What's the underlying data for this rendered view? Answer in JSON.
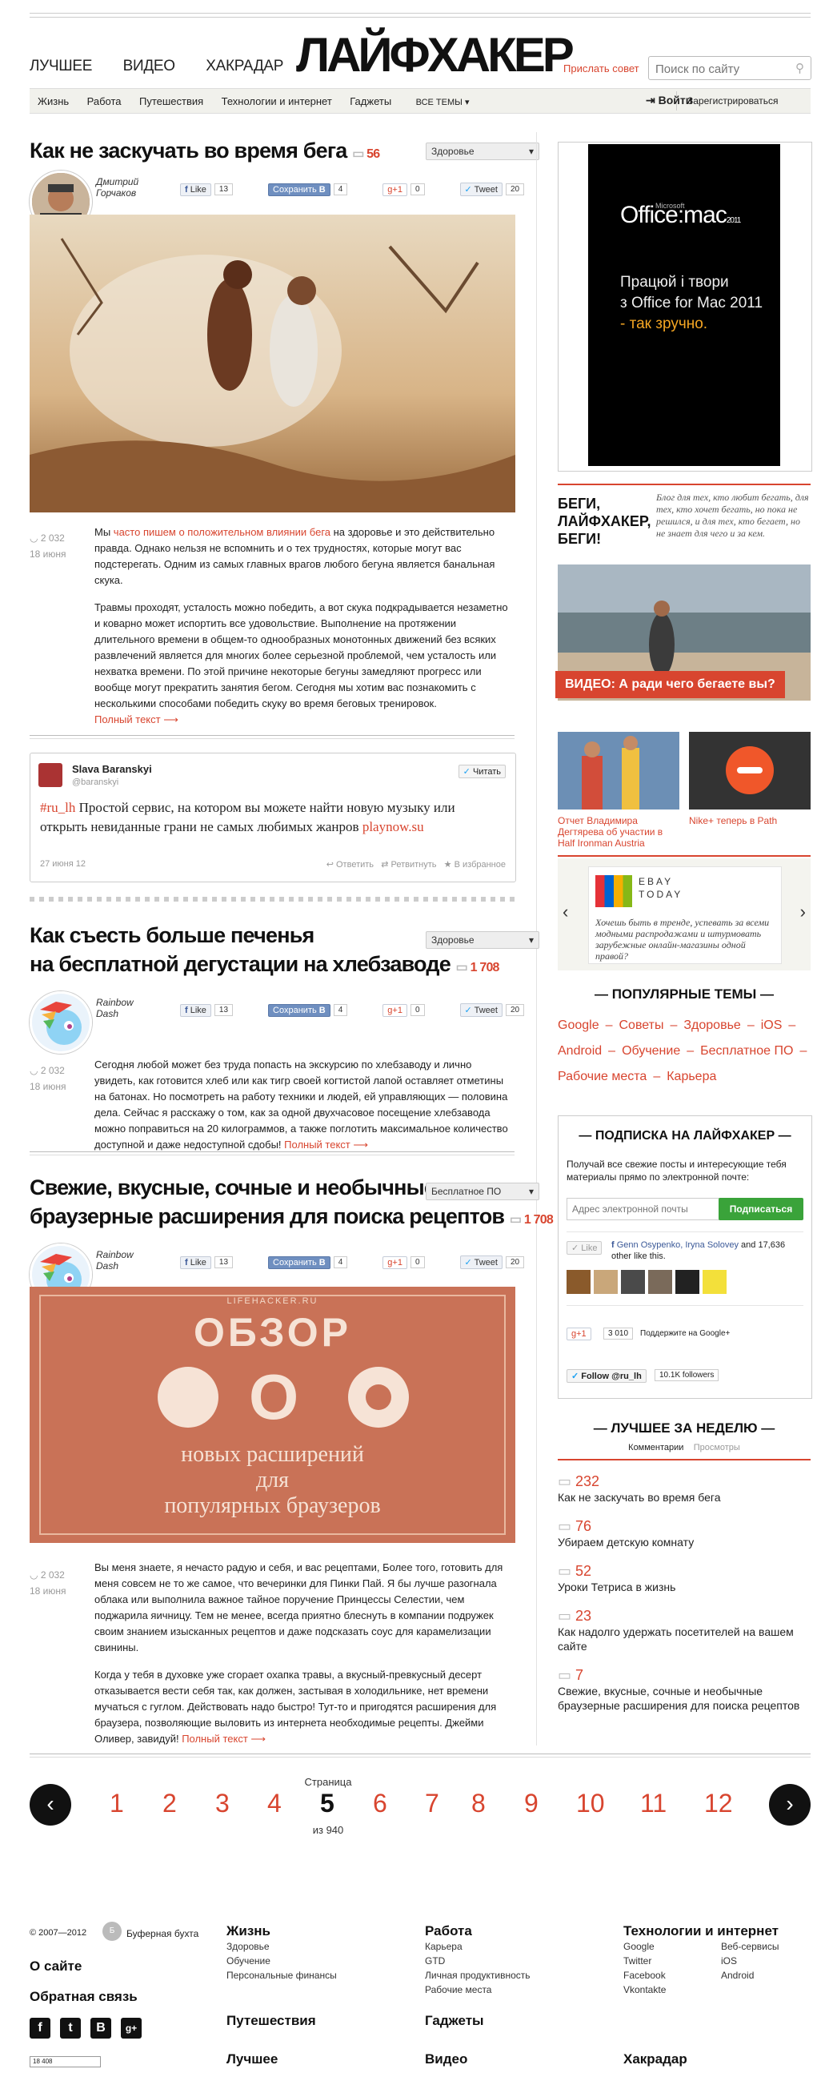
{
  "header": {
    "nav": [
      "ЛУЧШЕЕ",
      "ВИДЕО",
      "ХАКРАДАР"
    ],
    "logo": "ЛАЙФХАКЕР",
    "send_tip": "Прислать совет",
    "search_placeholder": "Поиск по сайту",
    "categories": [
      "Жизнь",
      "Работа",
      "Путешествия",
      "Технологии и интернет",
      "Гаджеты"
    ],
    "all_topics": "ВСЕ ТЕМЫ",
    "login": "Войти",
    "register": "Зарегистрироваться"
  },
  "share": {
    "like": "Like",
    "save": "Сохранить",
    "plus": "+1",
    "tweet": "Tweet"
  },
  "posts": [
    {
      "title": "Как не заскучать во время бега",
      "comments": "56",
      "tag": "Здоровье",
      "author_first": "Дмитрий",
      "author_last": "Горчаков",
      "like_count": "13",
      "save_count": "4",
      "plus_count": "0",
      "tweet_count": "20",
      "views": "2 032",
      "date": "18 июня",
      "p1_a": "Мы ",
      "p1_link": "часто пишем о положительном влиянии бега",
      "p1_b": " на здоровье и это действительно правда. Однако нельзя не вспомнить и о тех трудностях, которые могут вас подстерегать. Одним из самых главных врагов любого бегуна является банальная скука.",
      "p2": "Травмы проходят, усталость можно победить, а вот скука подкрадывается незаметно и коварно может испортить все удовольствие. Выполнение на протяжении длительного времени в общем-то однообразных монотонных движений без всяких развлечений является для многих более серьезной проблемой, чем усталость или нехватка времени. По этой причине некоторые бегуны замедляют прогресс или вообще могут прекратить занятия бегом. Сегодня мы хотим вас познакомить с несколькими способами победить скуку во время беговых тренировок.",
      "more": "Полный текст ⟶"
    },
    {
      "title_l1": "Как съесть больше печенья",
      "title_l2": "на бесплатной дегустации на хлебзаводе",
      "comments": "1 708",
      "tag": "Здоровье",
      "author_first": "Rainbow",
      "author_last": "Dash",
      "like_count": "13",
      "save_count": "4",
      "plus_count": "0",
      "tweet_count": "20",
      "views": "2 032",
      "date": "18 июня",
      "p1": "Сегодня любой может без труда попасть на экскурсию по хлебзаводу и лично увидеть, как готовится хлеб или как тигр своей когтистой лапой оставляет отметины на батонах. Но посмотреть на работу техники и людей, ей управляющих — половина дела. Сейчас я расскажу о том, как за одной двухчасовое посещение хлебзавода можно поправиться на 20 килограммов, а также поглотить максимальное количество доступной и даже недоступной сдобы! ",
      "more": "Полный текст ⟶"
    },
    {
      "title_l1": "Свежие, вкусные, сочные и необычные",
      "title_l2": "браузерные расширения для поиска рецептов",
      "comments": "1 708",
      "tag": "Бесплатное ПО",
      "author_first": "Rainbow",
      "author_last": "Dash",
      "like_count": "13",
      "save_count": "4",
      "plus_count": "0",
      "tweet_count": "20",
      "banner_site": "LIFEHACKER.RU",
      "banner_title": "ОБЗОР",
      "banner_line1": "новых расширений",
      "banner_line2": "для",
      "banner_line3": "популярных браузеров",
      "views": "2 032",
      "date": "18 июня",
      "p1": "Вы меня знаете, я нечасто радую и себя, и вас рецептами, Более того, готовить для меня совсем не то же самое, что вечеринки для Пинки Пай. Я бы лучше разогнала облака или выполнила важное тайное поручение Принцессы Селестии, чем поджарила яичницу. Тем не менее, всегда приятно блеснуть в компании подружек своим знанием изысканных рецептов и даже подсказать соус для карамелизации свинины.",
      "p2": "Когда у тебя в духовке уже сгорает охапка травы, а вкусный-превкусный десерт отказывается вести себя так, как должен, застывая в холодильнике, нет времени мучаться с гуглом. Действовать надо быстро! Тут-то и пригодятся расширения для браузера, позволяющие выловить из интернета необходимые рецепты. Джейми Оливер, завидуй! ",
      "more": "Полный текст ⟶"
    }
  ],
  "tweet": {
    "name": "Slava Baranskyi",
    "handle": "@baranskyi",
    "follow": "Читать",
    "hashtag": "#ru_lh",
    "text": " Простой сервис, на котором вы можете найти новую музыку или открыть невиданные грани не самых любимых жанров ",
    "link": "playnow.su",
    "date": "27 июня 12",
    "reply": "Ответить",
    "retweet": "Ретвитнуть",
    "fav": "В избранное"
  },
  "sidebar": {
    "ad_brand": "Office:mac",
    "ad_brand_small": "Microsoft",
    "ad_year": "2011",
    "ad_line1": "Працюй і твори",
    "ad_line2": "з Office for Mac 2011",
    "ad_line3": "- так зручно.",
    "run_title_l1": "БЕГИ,",
    "run_title_l2": "ЛАЙФХАКЕР,",
    "run_title_l3": "БЕГИ!",
    "run_desc": "Блог для тех, кто любит бегать, для тех, кто хочет бегать, но пока не решился, и для тех, кто бегает, но не знает для чего и за кем.",
    "video_caption": "ВИДЕО: А ради чего бегаете вы?",
    "small1": "Отчет Владимира Дегтярева об участии в Half Ironman Austria",
    "small2": "Nike+ теперь в Path",
    "ebay_l1": "EBAY",
    "ebay_l2": "TODAY",
    "ebay_text": "Хочешь быть в тренде, успевать за всеми модными распродажами и штурмовать зарубежные онлайн-магазины одной правой?",
    "popular_title": "ПОПУЛЯРНЫЕ ТЕМЫ",
    "topics": [
      "Google",
      "Советы",
      "Здоровье",
      "iOS",
      "Android",
      "Обучение",
      "Бесплатное ПО",
      "Рабочие места",
      "Карьера"
    ],
    "subscribe_title": "ПОДПИСКА НА ЛАЙФХАКЕР",
    "subscribe_text": "Получай все свежие посты и интересующие тебя материалы прямо по электронной почте:",
    "email_placeholder": "Адрес электронной почты",
    "subscribe_btn": "Подписаться",
    "fb_like": "Like",
    "fb_names": "Genn Osypenko, Iryna Solovey",
    "fb_rest": " and 17,636 other like this.",
    "gplus_count": "3 010",
    "gplus_text": "Поддержите на Google+",
    "follow_btn": "Follow @ru_lh",
    "followers": "10.1K followers",
    "week_title": "ЛУЧШЕЕ ЗА НЕДЕЛЮ",
    "week_tab1": "Комментарии",
    "week_tab2": "Просмотры",
    "week": [
      {
        "n": "232",
        "t": "Как не заскучать во время бега"
      },
      {
        "n": "76",
        "t": "Убираем детскую комнату"
      },
      {
        "n": "52",
        "t": "Уроки Тетриса в жизнь"
      },
      {
        "n": "23",
        "t": "Как надолго удержать посетителей на вашем сайте"
      },
      {
        "n": "7",
        "t": "Свежие, вкусные, сочные и необычные браузерные расширения для поиска рецептов"
      }
    ]
  },
  "pager": {
    "label": "Страница",
    "pages": [
      "1",
      "2",
      "3",
      "4",
      "5",
      "6",
      "7",
      "8",
      "9",
      "10",
      "11",
      "12"
    ],
    "current": "5",
    "of": "из 940",
    "prev": "‹",
    "next": "›"
  },
  "footer": {
    "copyright": "© 2007—2012",
    "buffer": "Буферная бухта",
    "about": "О сайте",
    "feedback": "Обратная связь",
    "social": [
      "f",
      "t",
      "B",
      "g+"
    ],
    "counter": "18 408",
    "col1_title": "Жизнь",
    "col1": [
      "Здоровье",
      "Обучение",
      "Персональные финансы"
    ],
    "col2_title": "Работа",
    "col2": [
      "Карьера",
      "GTD",
      "Личная продуктивность",
      "Рабочие места"
    ],
    "col3_title": "Технологии и интернет",
    "col3a": [
      "Google",
      "Twitter",
      "Facebook",
      "Vkontakte"
    ],
    "col3b": [
      "Веб-сервисы",
      "iOS",
      "Android"
    ],
    "travel": "Путешествия",
    "gadgets": "Гаджеты",
    "best": "Лучшее",
    "video": "Видео",
    "radar": "Хакрадар"
  }
}
